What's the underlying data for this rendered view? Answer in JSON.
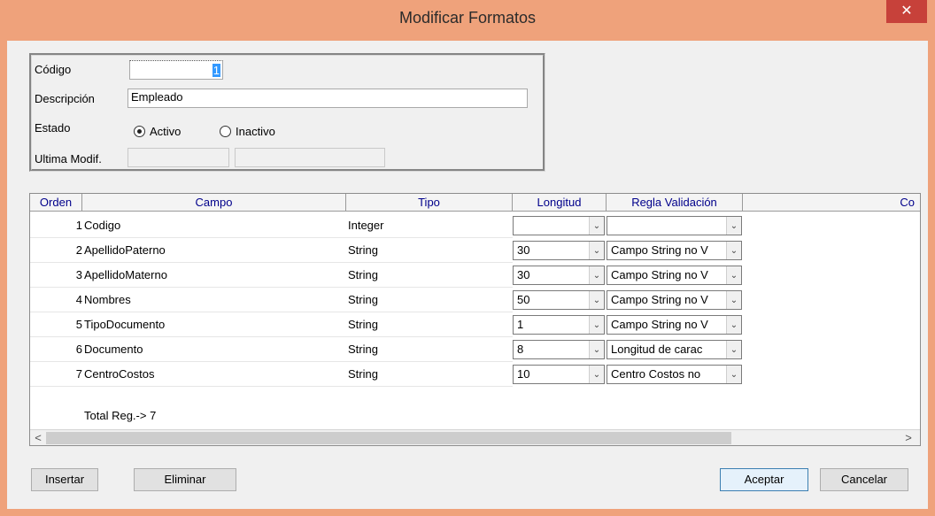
{
  "window": {
    "title": "Modificar Formatos",
    "close_glyph": "✕"
  },
  "form": {
    "codigo_label": "Código",
    "codigo_value": "1",
    "descripcion_label": "Descripción",
    "descripcion_value": "Empleado",
    "estado_label": "Estado",
    "activo_label": "Activo",
    "inactivo_label": "Inactivo",
    "estado_selected": "Activo",
    "ultima_label": "Ultima Modif.",
    "ultima_value_1": "",
    "ultima_value_2": ""
  },
  "grid": {
    "headers": [
      "Orden",
      "Campo",
      "Tipo",
      "Longitud",
      "Regla Validación",
      "Co"
    ],
    "rows": [
      {
        "orden": "1",
        "campo": "Codigo",
        "tipo": "Integer",
        "longitud": "",
        "regla": ""
      },
      {
        "orden": "2",
        "campo": "ApellidoPaterno",
        "tipo": "String",
        "longitud": "30",
        "regla": "Campo String no V"
      },
      {
        "orden": "3",
        "campo": "ApellidoMaterno",
        "tipo": "String",
        "longitud": "30",
        "regla": "Campo String no V"
      },
      {
        "orden": "4",
        "campo": "Nombres",
        "tipo": "String",
        "longitud": "50",
        "regla": "Campo String no V"
      },
      {
        "orden": "5",
        "campo": "TipoDocumento",
        "tipo": "String",
        "longitud": "1",
        "regla": "Campo String no V"
      },
      {
        "orden": "6",
        "campo": "Documento",
        "tipo": "String",
        "longitud": "8",
        "regla": "Longitud de carac"
      },
      {
        "orden": "7",
        "campo": "CentroCostos",
        "tipo": "String",
        "longitud": "10",
        "regla": "Centro Costos no"
      }
    ],
    "total_label": "Total Reg.-> 7",
    "scroll_left_glyph": "<",
    "scroll_right_glyph": ">",
    "dropdown_glyph": "⌄"
  },
  "buttons": {
    "insertar": "Insertar",
    "eliminar": "Eliminar",
    "aceptar": "Aceptar",
    "cancelar": "Cancelar"
  },
  "colors": {
    "titlebar": "#efa27b",
    "close": "#c7413a",
    "header_text": "#00008b",
    "selection": "#3399ff"
  }
}
